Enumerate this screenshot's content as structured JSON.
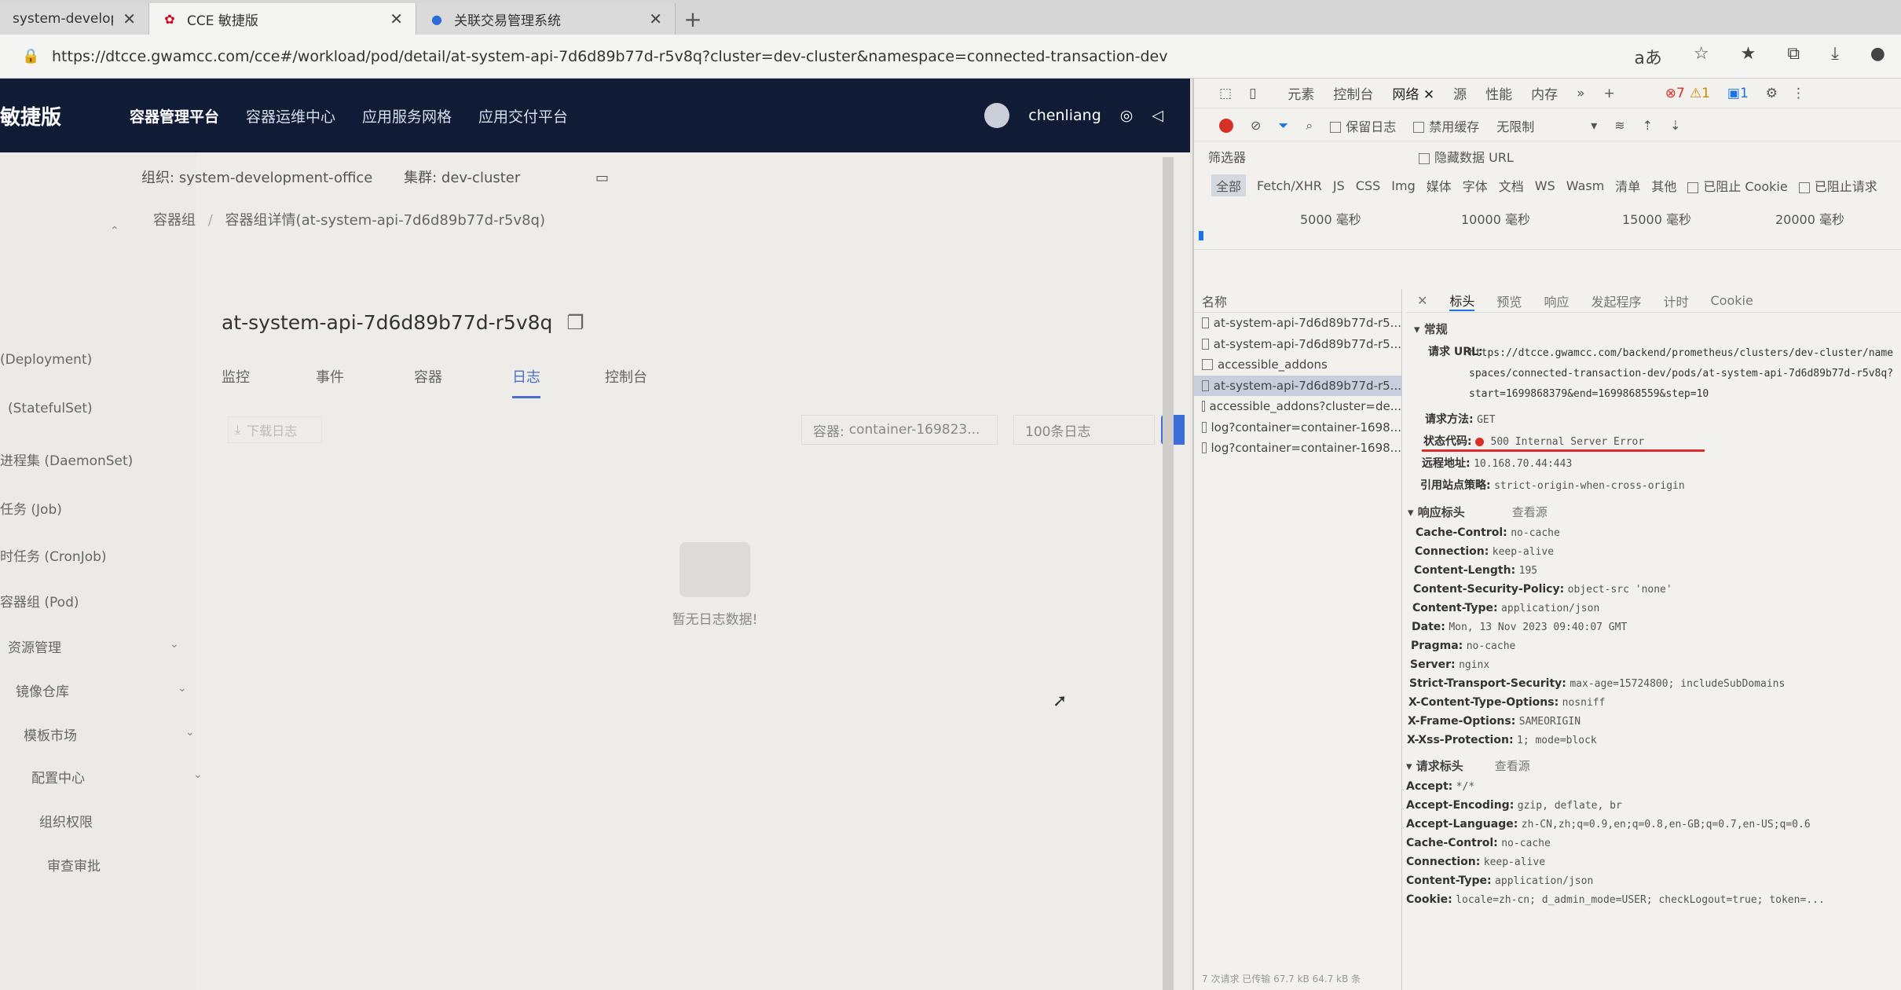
{
  "browser": {
    "tabs": [
      {
        "label": "system-developmer",
        "icon": "page-icon",
        "active": false
      },
      {
        "label": "CCE 敏捷版",
        "icon": "huawei-logo-icon",
        "active": true
      },
      {
        "label": "关联交易管理系统",
        "icon": "app-logo-icon",
        "active": false
      }
    ],
    "url": "https://dtcce.gwamcc.com/cce#/workload/pod/detail/at-system-api-7d6d89b77d-r5v8q?cluster=dev-cluster&namespace=connected-transaction-dev"
  },
  "app": {
    "brand": "敏捷版",
    "nav": [
      "容器管理平台",
      "容器运维中心",
      "应用服务网格",
      "应用交付平台"
    ],
    "nav_active": 0,
    "user": "chenliang",
    "org_label": "组织:",
    "org_value": "system-development-office",
    "cluster_label": "集群:",
    "cluster_value": "dev-cluster",
    "breadcrumb": [
      "容器组",
      "容器组详情(at-system-api-7d6d89b77d-r5v8q)"
    ],
    "sidebar": [
      "(Deployment)",
      "(StatefulSet)",
      "进程集 (DaemonSet)",
      "任务 (Job)",
      "时任务 (CronJob)",
      "容器组 (Pod)",
      "资源管理",
      "镜像仓库",
      "模板市场",
      "配置中心",
      "组织权限",
      "审查审批"
    ],
    "pod_name": "at-system-api-7d6d89b77d-r5v8q",
    "pod_tabs": [
      "监控",
      "事件",
      "容器",
      "日志",
      "控制台"
    ],
    "pod_tab_active": 3,
    "download_logs": "下载日志",
    "container_label": "容器:",
    "container_value": "container-169823...",
    "lines_value": "100条日志",
    "empty_text": "暂无日志数据!"
  },
  "devtools": {
    "tabs": [
      "元素",
      "控制台",
      "网络",
      "源",
      "性能",
      "内存"
    ],
    "active_tab": 2,
    "error_count": "7",
    "warn_count": "1",
    "msg_count": "1",
    "toolbar": {
      "preserve_log": "保留日志",
      "disable_cache": "禁用缓存",
      "throttle": "无限制"
    },
    "filter_label": "筛选器",
    "hide_data_urls": "隐藏数据 URL",
    "types": [
      "全部",
      "Fetch/XHR",
      "JS",
      "CSS",
      "Img",
      "媒体",
      "字体",
      "文档",
      "WS",
      "Wasm",
      "清单",
      "其他"
    ],
    "blocked_cookies": "已阻止 Cookie",
    "blocked_requests": "已阻止请求",
    "timeline_labels": [
      "5000 毫秒",
      "10000 毫秒",
      "15000 毫秒",
      "20000 毫秒"
    ],
    "name_header": "名称",
    "requests": [
      "at-system-api-7d6d89b77d-r5...",
      "at-system-api-7d6d89b77d-r5...",
      "accessible_addons",
      "at-system-api-7d6d89b77d-r5...",
      "accessible_addons?cluster=de...",
      "log?container=container-1698...",
      "log?container=container-1698..."
    ],
    "selected_request": 3,
    "status_bar": "7 次请求  已传输 67.7 kB  64.7 kB 条",
    "detail_tabs": [
      "标头",
      "预览",
      "响应",
      "发起程序",
      "计时",
      "Cookie"
    ],
    "detail_tab_active": 0,
    "general_title": "常规",
    "general": {
      "url_label": "请求 URL:",
      "url_value": "https://dtcce.gwamcc.com/backend/prometheus/clusters/dev-cluster/namespaces/connected-transaction-dev/pods/at-system-api-7d6d89b77d-r5v8q?start=1699868379&end=1699868559&step=10",
      "method_label": "请求方法:",
      "method_value": "GET",
      "status_label": "状态代码:",
      "status_value": "500 Internal Server Error",
      "remote_label": "远程地址:",
      "remote_value": "10.168.70.44:443",
      "referrer_label": "引用站点策略:",
      "referrer_value": "strict-origin-when-cross-origin"
    },
    "response_headers_title": "响应标头",
    "view_source": "查看源",
    "response_headers": [
      {
        "k": "Cache-Control:",
        "v": "no-cache"
      },
      {
        "k": "Connection:",
        "v": "keep-alive"
      },
      {
        "k": "Content-Length:",
        "v": "195"
      },
      {
        "k": "Content-Security-Policy:",
        "v": "object-src 'none'"
      },
      {
        "k": "Content-Type:",
        "v": "application/json"
      },
      {
        "k": "Date:",
        "v": "Mon, 13 Nov 2023 09:40:07 GMT"
      },
      {
        "k": "Pragma:",
        "v": "no-cache"
      },
      {
        "k": "Server:",
        "v": "nginx"
      },
      {
        "k": "Strict-Transport-Security:",
        "v": "max-age=15724800; includeSubDomains"
      },
      {
        "k": "X-Content-Type-Options:",
        "v": "nosniff"
      },
      {
        "k": "X-Frame-Options:",
        "v": "SAMEORIGIN"
      },
      {
        "k": "X-Xss-Protection:",
        "v": "1; mode=block"
      }
    ],
    "request_headers_title": "请求标头",
    "request_headers": [
      {
        "k": "Accept:",
        "v": "*/*"
      },
      {
        "k": "Accept-Encoding:",
        "v": "gzip, deflate, br"
      },
      {
        "k": "Accept-Language:",
        "v": "zh-CN,zh;q=0.9,en;q=0.8,en-GB;q=0.7,en-US;q=0.6"
      },
      {
        "k": "Cache-Control:",
        "v": "no-cache"
      },
      {
        "k": "Connection:",
        "v": "keep-alive"
      },
      {
        "k": "Content-Type:",
        "v": "application/json"
      },
      {
        "k": "Cookie:",
        "v": "locale=zh-cn; d_admin_mode=USER; checkLogout=true; token=..."
      }
    ]
  }
}
